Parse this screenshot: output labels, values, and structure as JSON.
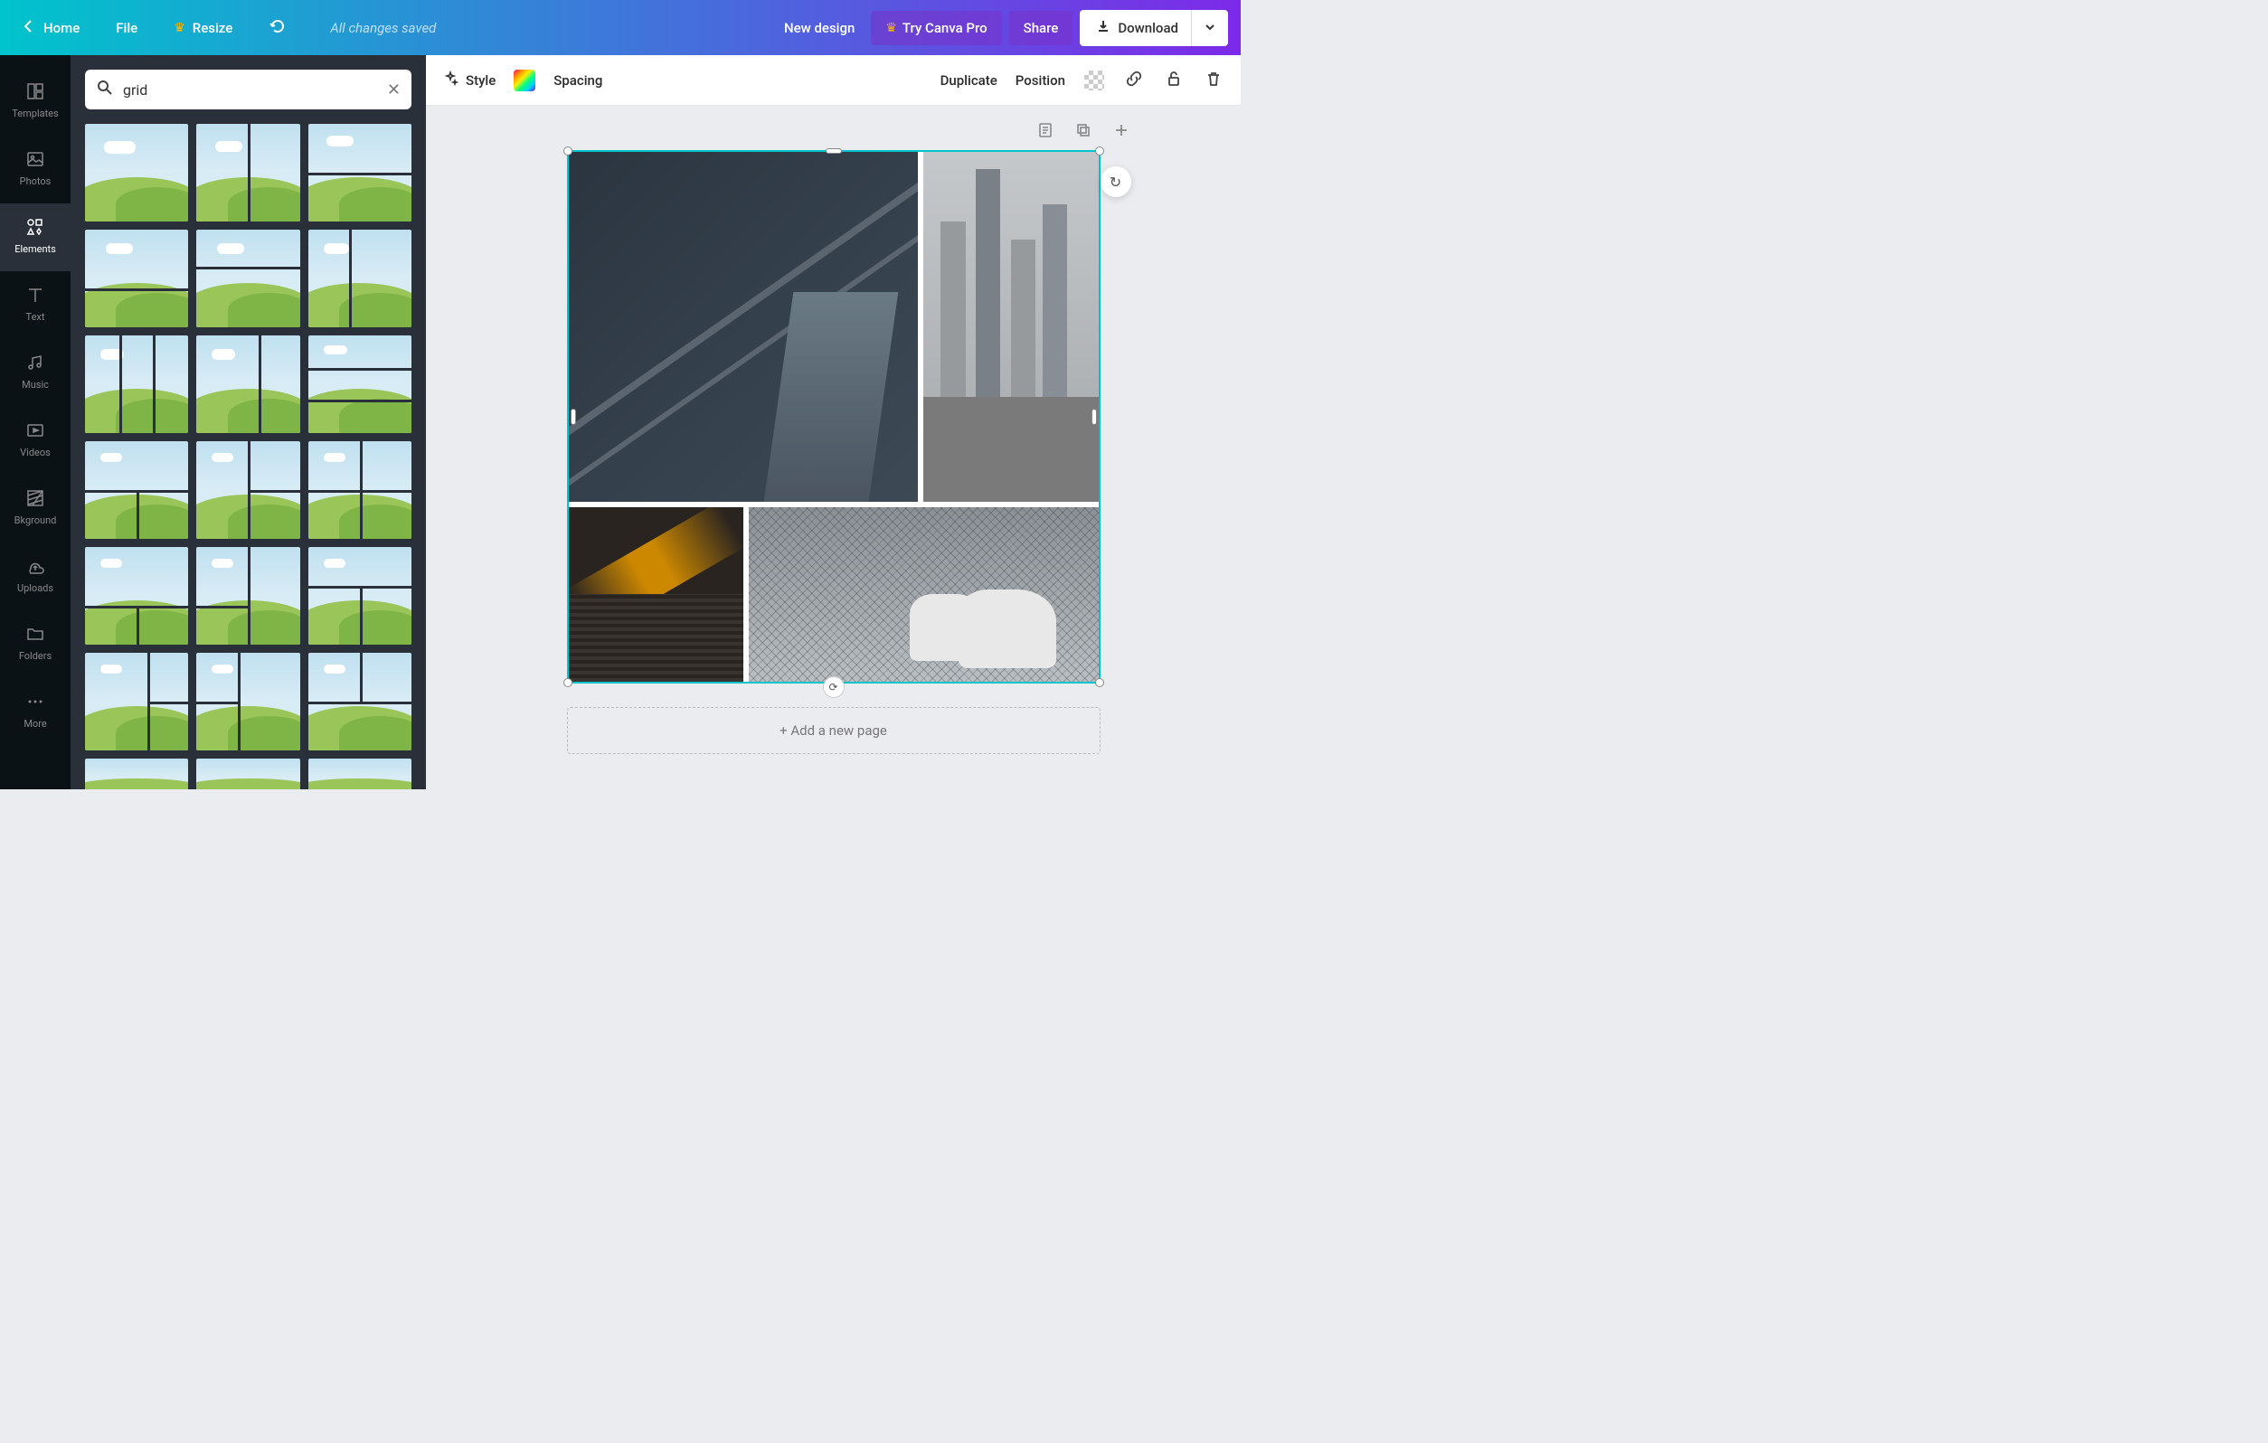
{
  "header": {
    "home": "Home",
    "file": "File",
    "resize": "Resize",
    "status": "All changes saved",
    "new_design": "New design",
    "try_pro": "Try Canva Pro",
    "share": "Share",
    "download": "Download"
  },
  "sidebar": {
    "items": [
      {
        "label": "Templates",
        "icon": "templates"
      },
      {
        "label": "Photos",
        "icon": "photos"
      },
      {
        "label": "Elements",
        "icon": "elements"
      },
      {
        "label": "Text",
        "icon": "text"
      },
      {
        "label": "Music",
        "icon": "music"
      },
      {
        "label": "Videos",
        "icon": "videos"
      },
      {
        "label": "Bkground",
        "icon": "background"
      },
      {
        "label": "Uploads",
        "icon": "uploads"
      },
      {
        "label": "Folders",
        "icon": "folders"
      },
      {
        "label": "More",
        "icon": "more"
      }
    ],
    "active": "Elements"
  },
  "search": {
    "value": "grid"
  },
  "toolbar": {
    "style": "Style",
    "spacing": "Spacing",
    "duplicate": "Duplicate",
    "position": "Position"
  },
  "canvas": {
    "add_page": "+ Add a new page"
  }
}
